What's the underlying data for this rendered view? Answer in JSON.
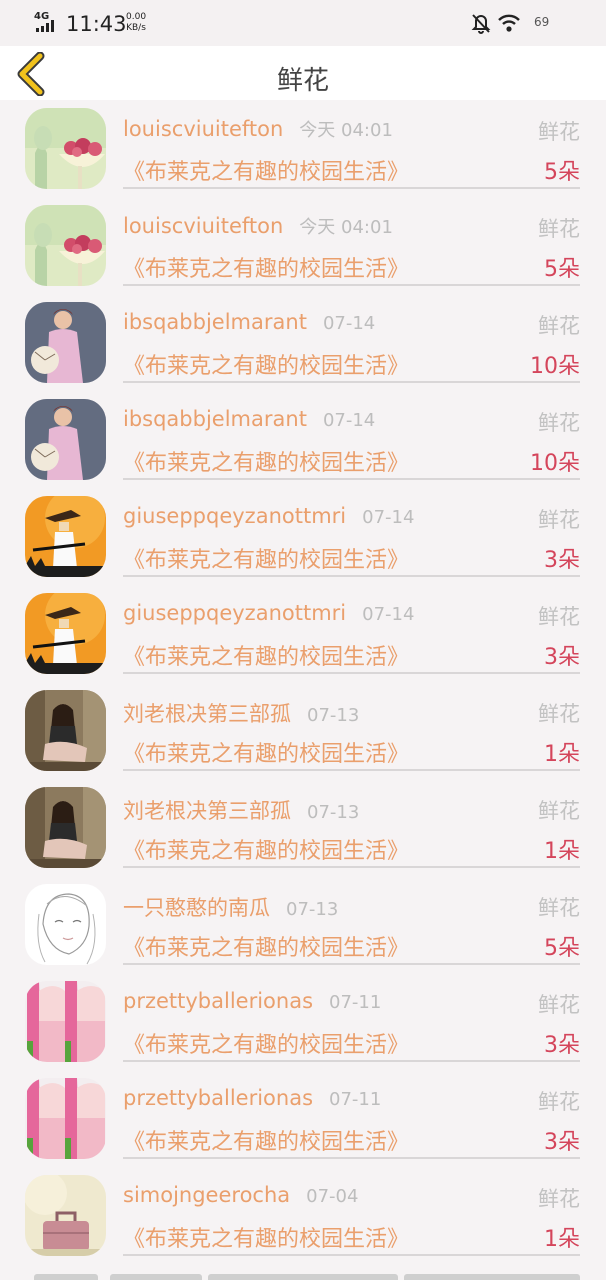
{
  "status_bar": {
    "network": "4G",
    "time": "11:43",
    "speed_value": "0.00",
    "speed_unit": "KB/s",
    "battery": "69"
  },
  "header": {
    "title": "鲜花",
    "back_icon": "chevron-left-icon",
    "accent": "#f1c21c"
  },
  "colors": {
    "name": "#ea9f6c",
    "count": "#d4455b",
    "muted": "#bdbdbd"
  },
  "items": [
    {
      "user": "louiscviuitefton",
      "time": "今天 04:01",
      "gift": "鲜花",
      "book": "《布莱克之有趣的校园生活》",
      "count": "5朵",
      "avatar": "flower-bowl"
    },
    {
      "user": "louiscviuitefton",
      "time": "今天 04:01",
      "gift": "鲜花",
      "book": "《布莱克之有趣的校园生活》",
      "count": "5朵",
      "avatar": "flower-bowl"
    },
    {
      "user": "ibsqabbjelmarant",
      "time": "07-14",
      "gift": "鲜花",
      "book": "《布莱克之有趣的校园生活》",
      "count": "10朵",
      "avatar": "woman-fan"
    },
    {
      "user": "ibsqabbjelmarant",
      "time": "07-14",
      "gift": "鲜花",
      "book": "《布莱克之有趣的校园生活》",
      "count": "10朵",
      "avatar": "woman-fan"
    },
    {
      "user": "giuseppqeyzanottmri",
      "time": "07-14",
      "gift": "鲜花",
      "book": "《布莱克之有趣的校园生活》",
      "count": "3朵",
      "avatar": "samurai"
    },
    {
      "user": "giuseppqeyzanottmri",
      "time": "07-14",
      "gift": "鲜花",
      "book": "《布莱克之有趣的校园生活》",
      "count": "3朵",
      "avatar": "samurai"
    },
    {
      "user": "刘老根决第三部孤",
      "time": "07-13",
      "gift": "鲜花",
      "book": "《布莱克之有趣的校园生活》",
      "count": "1朵",
      "avatar": "girl-sitting"
    },
    {
      "user": "刘老根决第三部孤",
      "time": "07-13",
      "gift": "鲜花",
      "book": "《布莱克之有趣的校园生活》",
      "count": "1朵",
      "avatar": "girl-sitting"
    },
    {
      "user": "一只憨憨的南瓜",
      "time": "07-13",
      "gift": "鲜花",
      "book": "《布莱克之有趣的校园生活》",
      "count": "5朵",
      "avatar": "sketch-girl"
    },
    {
      "user": "przettyballerionas",
      "time": "07-11",
      "gift": "鲜花",
      "book": "《布莱克之有趣的校园生活》",
      "count": "3朵",
      "avatar": "anime-pink"
    },
    {
      "user": "przettyballerionas",
      "time": "07-11",
      "gift": "鲜花",
      "book": "《布莱克之有趣的校园生活》",
      "count": "3朵",
      "avatar": "anime-pink"
    },
    {
      "user": "simojngeerocha",
      "time": "07-04",
      "gift": "鲜花",
      "book": "《布莱克之有趣的校园生活》",
      "count": "1朵",
      "avatar": "suitcase"
    }
  ]
}
